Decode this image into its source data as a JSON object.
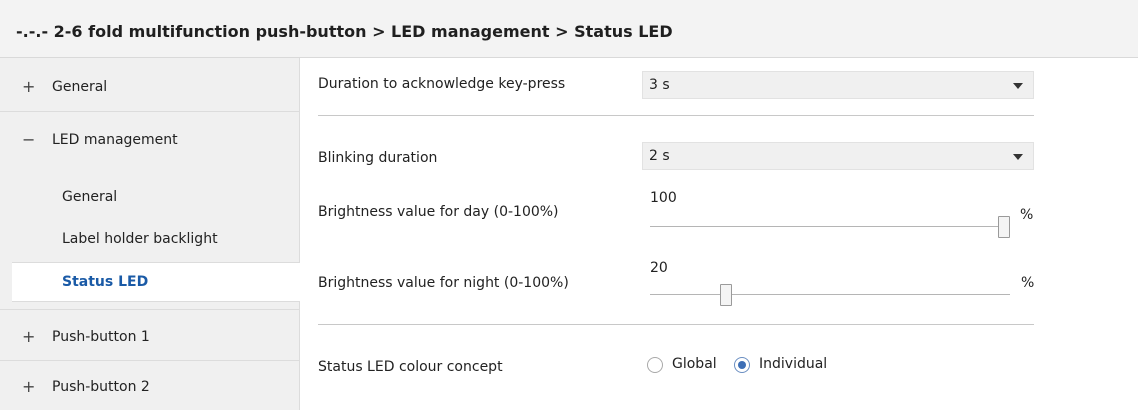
{
  "header": {
    "title": "-.-.- 2-6 fold multifunction push-button > LED management > Status LED"
  },
  "sidebar": {
    "items": [
      {
        "sign": "+",
        "label": "General"
      },
      {
        "sign": "−",
        "label": "LED management"
      },
      {
        "label": "General"
      },
      {
        "label": "Label holder backlight"
      },
      {
        "label": "Status LED"
      },
      {
        "sign": "+",
        "label": "Push-button 1"
      },
      {
        "sign": "+",
        "label": "Push-button 2"
      }
    ]
  },
  "params": {
    "ack_label": "Duration to acknowledge key-press",
    "ack_value": "3 s",
    "blink_label": "Blinking duration",
    "blink_value": "2 s",
    "day_label": "Brightness value for day (0-100%)",
    "day_value": "100",
    "day_level": 100,
    "night_label": "Brightness value for night (0-100%)",
    "night_value": "20",
    "night_level": 20,
    "unit": "%",
    "colour_label": "Status LED colour concept",
    "colour_options": [
      "Global",
      "Individual"
    ],
    "colour_selected": "Individual"
  }
}
